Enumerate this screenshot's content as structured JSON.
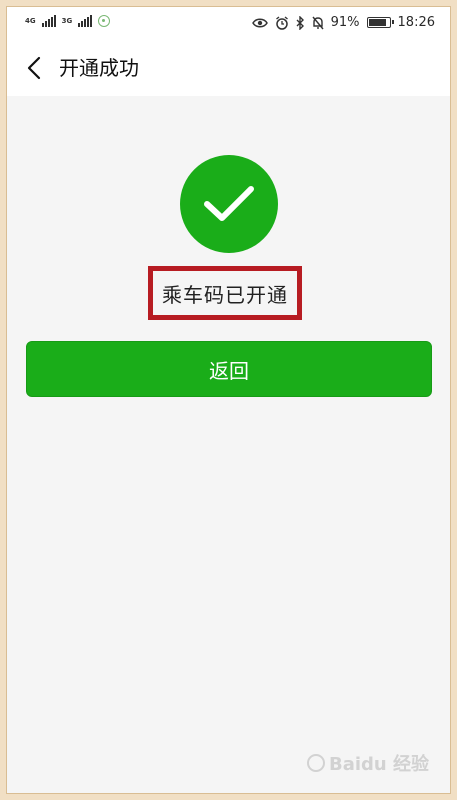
{
  "status_bar": {
    "network_tag_1": "4G",
    "network_tag_2": "3G",
    "battery_text": "91%",
    "battery_level": 0.91,
    "time": "18:26"
  },
  "header": {
    "title": "开通成功"
  },
  "result": {
    "message": "乘车码已开通"
  },
  "actions": {
    "return_label": "返回"
  },
  "watermark": {
    "text": "Baidu 经验"
  },
  "colors": {
    "accent": "#1aad19",
    "highlight": "#b71c22",
    "background": "#f5f5f5",
    "frame": "#f1dfc4"
  },
  "icons": {
    "back": "chevron-left-icon",
    "success": "checkmark-circle-icon",
    "eye": "eye-icon",
    "alarm": "alarm-icon",
    "bluetooth": "bluetooth-icon",
    "mute": "bell-off-icon",
    "battery": "battery-icon"
  }
}
